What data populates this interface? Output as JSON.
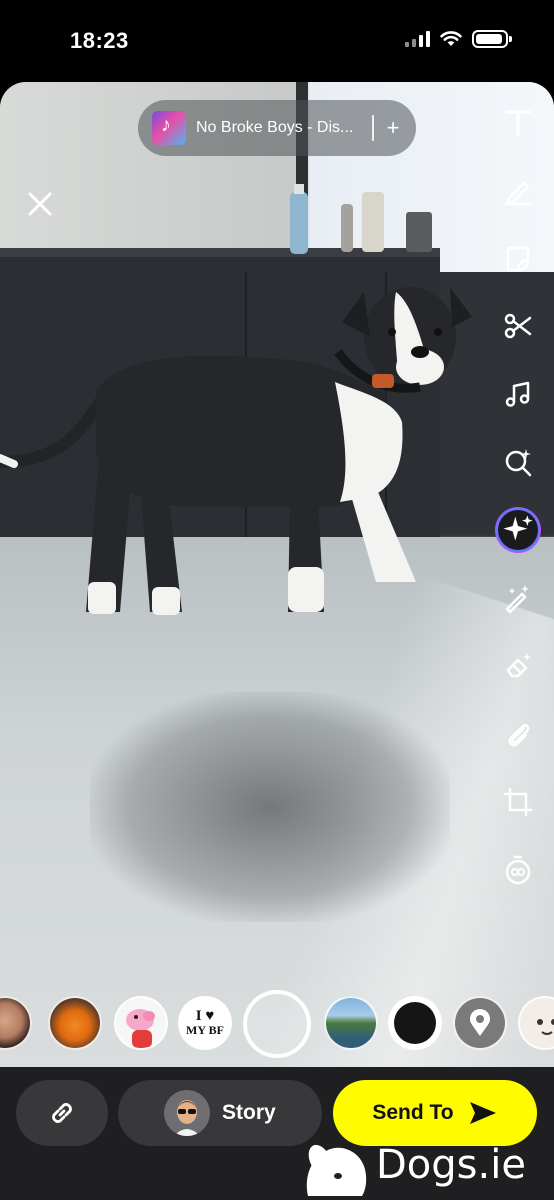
{
  "status_bar": {
    "time": "18:23",
    "signal_icon": "cellular-signal-icon",
    "wifi_icon": "wifi-icon",
    "battery_icon": "battery-icon"
  },
  "editor": {
    "close_icon": "close-icon",
    "music": {
      "title": "No Broke Boys - Dis...",
      "add_label": "+"
    },
    "tools": [
      {
        "name": "text-tool",
        "icon": "text-icon"
      },
      {
        "name": "draw-tool",
        "icon": "pencil-icon"
      },
      {
        "name": "sticker-tool",
        "icon": "sticker-icon"
      },
      {
        "name": "scissors-tool",
        "icon": "scissors-icon"
      },
      {
        "name": "music-tool",
        "icon": "music-note-icon"
      },
      {
        "name": "lens-search-tool",
        "icon": "magnify-sparkle-icon"
      },
      {
        "name": "ai-tool",
        "icon": "sparkle-icon"
      },
      {
        "name": "magic-tool",
        "icon": "magic-wand-icon"
      },
      {
        "name": "eraser-tool",
        "icon": "magic-eraser-icon"
      },
      {
        "name": "attach-link-tool",
        "icon": "paperclip-icon"
      },
      {
        "name": "crop-tool",
        "icon": "crop-icon"
      },
      {
        "name": "timer-tool",
        "icon": "infinity-timer-icon"
      }
    ]
  },
  "lenses": [
    {
      "name": "lens-face"
    },
    {
      "name": "lens-orange-mask"
    },
    {
      "name": "lens-peppa-pig"
    },
    {
      "name": "lens-i-love-my-bf",
      "text_line1": "I ♥",
      "text_line2": "MY BF"
    },
    {
      "name": "lens-capture"
    },
    {
      "name": "lens-landscape"
    },
    {
      "name": "lens-black-circle"
    },
    {
      "name": "lens-location-pin"
    },
    {
      "name": "lens-cat-sticker"
    }
  ],
  "bottom_bar": {
    "link_icon": "link-icon",
    "story_label": "Story",
    "send_label": "Send To",
    "send_icon": "send-arrow-icon"
  },
  "watermark": {
    "text": "Dogs.ie"
  },
  "colors": {
    "send_button": "#fffc00",
    "bottom_bar": "#1f1f21",
    "pill": "#38383b"
  }
}
